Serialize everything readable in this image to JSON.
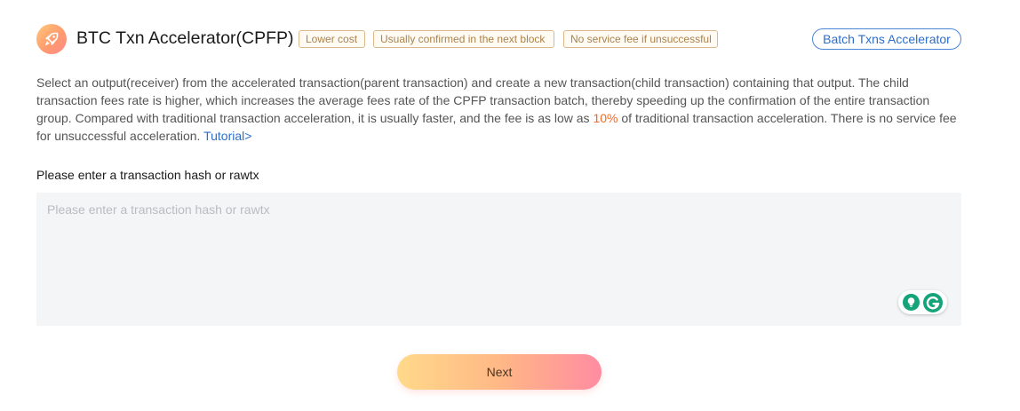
{
  "header": {
    "title": "BTC Txn Accelerator(CPFP)",
    "tags": [
      "Lower cost",
      "Usually confirmed in the next block",
      "No service fee if unsuccessful"
    ],
    "batch_button": "Batch Txns Accelerator",
    "logo_icon": "rocket-icon"
  },
  "description": {
    "text_before": "Select an output(receiver) from the accelerated transaction(parent transaction) and create a new transaction(child transaction) containing that output. The child transaction fees rate is higher, which increases the average fees rate of the CPFP transaction batch, thereby speeding up the confirmation of the entire transaction group. Compared with traditional transaction acceleration, it is usually faster, and the fee is as low as ",
    "highlight": "10%",
    "text_after": " of traditional transaction acceleration. There is no service fee for unsuccessful acceleration. ",
    "tutorial_link": "Tutorial>"
  },
  "form": {
    "label": "Please enter a transaction hash or rawtx",
    "placeholder": "Please enter a transaction hash or rawtx",
    "value": ""
  },
  "grammarly": {
    "icons": [
      "lightbulb-icon",
      "grammarly-icon"
    ]
  },
  "actions": {
    "next_label": "Next"
  },
  "colors": {
    "accent_blue": "#2d6ec9",
    "highlight_orange": "#f26a21",
    "tag_text": "#a9834d",
    "grammarly_green": "#15a37a"
  }
}
